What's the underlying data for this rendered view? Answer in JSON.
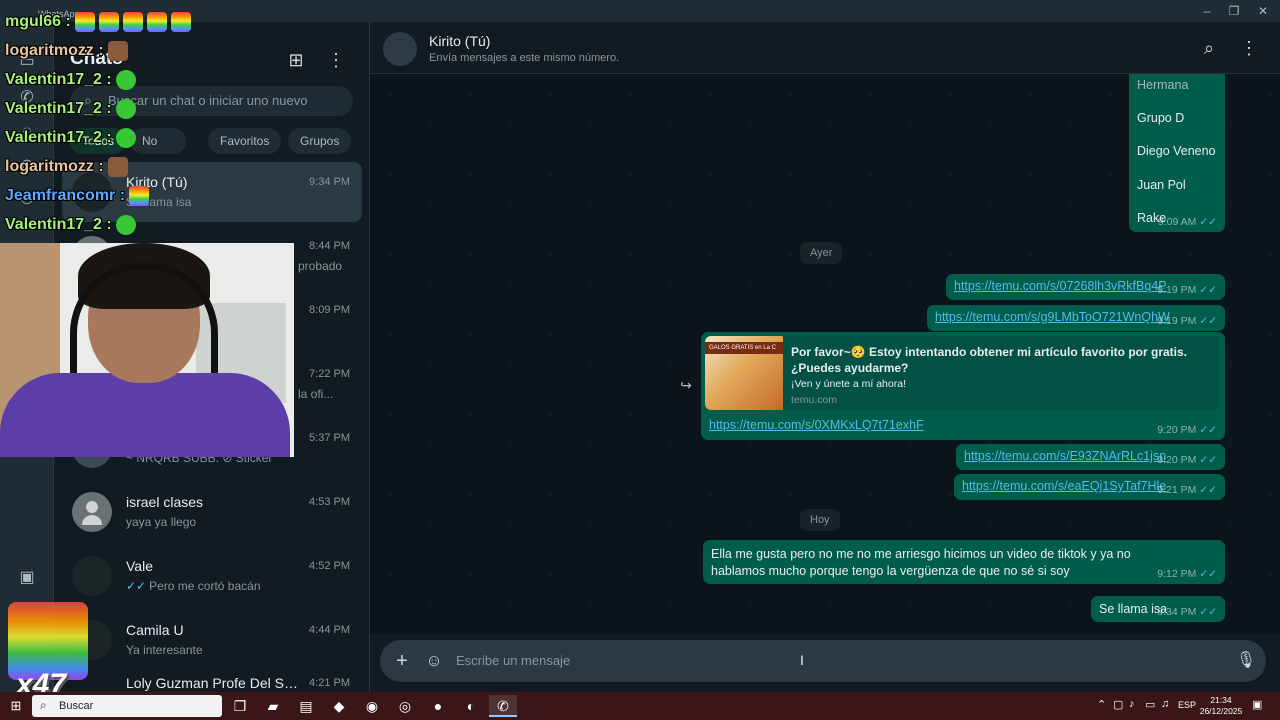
{
  "window": {
    "app_name": "WhatsApp",
    "minimize": "–",
    "maximize": "❐",
    "close": "✕"
  },
  "panel": {
    "title": "Chats",
    "new_chat_icon": "⊞",
    "menu_icon": "⋮",
    "search_placeholder": "Buscar un chat o iniciar uno nuevo",
    "filters": [
      "Todos",
      "No leídos",
      "Favoritos",
      "Grupos"
    ],
    "chats": [
      {
        "name": "Kirito (Tú)",
        "time": "9:34 PM",
        "preview": "Se llama isa"
      },
      {
        "name": "",
        "time": "8:44 PM",
        "preview": "probado"
      },
      {
        "name": "",
        "time": "8:09 PM",
        "preview": ""
      },
      {
        "name": "",
        "time": "7:22 PM",
        "preview": "la ofi..."
      },
      {
        "name": "",
        "time": "5:37 PM",
        "preview": "~ NRQRB SUBB: ⊘ Sticker"
      },
      {
        "name": "israel clases",
        "time": "4:53 PM",
        "preview": "yaya ya llego"
      },
      {
        "name": "Vale",
        "time": "4:52 PM",
        "preview": "Pero me cortó bacán"
      },
      {
        "name": "Camila U",
        "time": "4:44 PM",
        "preview": "Ya interesante"
      },
      {
        "name": "Loly Guzman Profe Del Sen...",
        "time": "4:21 PM",
        "preview": ""
      }
    ]
  },
  "conversation": {
    "name": "Kirito (Tú)",
    "subtitle": "Envía mensajes a este mismo número.",
    "list_items": [
      "Hermana",
      "Grupo D",
      "Diego Veneno",
      "Juan Pol",
      "Rake"
    ],
    "list_time": "9:09 AM",
    "sep_ayer": "Ayer",
    "sep_hoy": "Hoy",
    "links": [
      {
        "url": "https://temu.com/s/07268lh3vRkfBq4P",
        "time": "9:19 PM"
      },
      {
        "url": "https://temu.com/s/g9LMbToO721WnQhW",
        "time": "9:19 PM"
      }
    ],
    "preview_card": {
      "title": "Por favor~🥺 Estoy intentando obtener mi artículo favorito por gratis. ¿Puedes ayudarme?",
      "desc": "¡Ven y únete a mí ahora!",
      "domain": "temu.com",
      "img_text": "GALOS GRATIS en La C",
      "link": "https://temu.com/s/0XMKxLQ7t71exhF",
      "time": "9:20 PM"
    },
    "links2": [
      {
        "url": "https://temu.com/s/E93ZNArRLc1jsn",
        "time": "9:20 PM"
      },
      {
        "url": "https://temu.com/s/eaEQj1SyTaf7Hle",
        "time": "9:21 PM"
      }
    ],
    "long_msg": {
      "text": "Ella me gusta pero no me no me arriesgo hicimos un video de tiktok y ya no hablamos mucho porque tengo la vergüenza de que no sé si soy",
      "time": "9:12 PM"
    },
    "last_msg": {
      "text": "Se llama isa",
      "time": "9:34 PM"
    },
    "composer_placeholder": "Escribe un mensaje"
  },
  "overlay": {
    "lines": [
      {
        "user": "mgul66 :",
        "color": "green"
      },
      {
        "user": "logaritmozz :",
        "color": "tan"
      },
      {
        "user": "Valentin17_2 :",
        "color": "green"
      },
      {
        "user": "Valentin17_2 :",
        "color": "green"
      },
      {
        "user": "Valentin17_2 :",
        "color": "green"
      },
      {
        "user": "logaritmozz :",
        "color": "tan"
      },
      {
        "user": "Jeamfrancomr :",
        "color": "blue"
      },
      {
        "user": "Valentin17_2 :",
        "color": "green"
      }
    ],
    "badge_count": "x47"
  },
  "taskbar": {
    "search": "Buscar",
    "lang": "ESP",
    "time": "21:34",
    "date": "26/12/2025"
  },
  "colors": {
    "outgoing_bubble": "#005c4b",
    "link": "#53bdeb",
    "read_tick": "#53bdeb",
    "background": "#0b141a"
  }
}
